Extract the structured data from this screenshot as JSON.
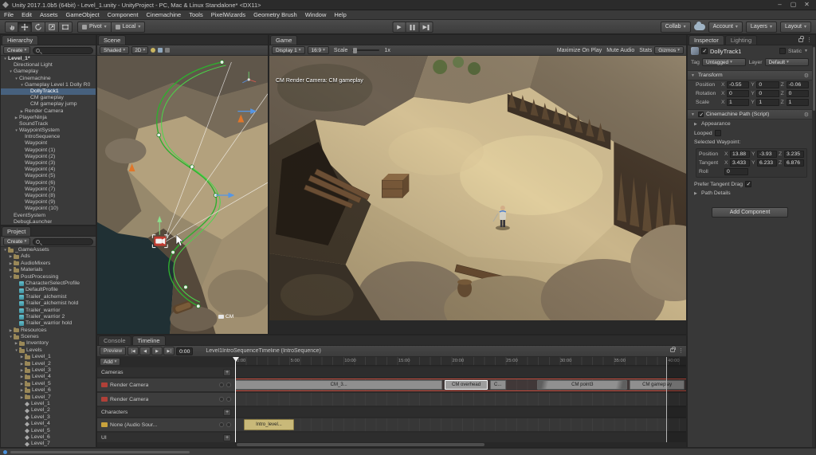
{
  "window": {
    "title": "Unity 2017.1.0b5 (64bit) - Level_1.unity - UnityProject - PC, Mac & Linux Standalone* <DX11>",
    "minimize": "–",
    "maximize": "▢",
    "close": "✕"
  },
  "menu": [
    "File",
    "Edit",
    "Assets",
    "GameObject",
    "Component",
    "Cinemachine",
    "Tools",
    "PixelWizards",
    "Geometry Brush",
    "Window",
    "Help"
  ],
  "toolbar": {
    "pivot_label": "Pivot",
    "local_label": "Local",
    "collab_label": "Collab",
    "account_label": "Account",
    "layers_label": "Layers",
    "layout_label": "Layout"
  },
  "hierarchy": {
    "tab": "Hierarchy",
    "create_label": "Create",
    "items": [
      {
        "label": "Level_1*",
        "indent": 0,
        "arrow": "v",
        "kind": "scene"
      },
      {
        "label": "Directional Light",
        "indent": 1
      },
      {
        "label": "Gameplay",
        "indent": 1,
        "arrow": "v"
      },
      {
        "label": "Cinemachine",
        "indent": 2,
        "arrow": "v"
      },
      {
        "label": "Gameplay Level 1 Dolly R0",
        "indent": 3,
        "arrow": "v"
      },
      {
        "label": "DollyTrack1",
        "indent": 4,
        "selected": true
      },
      {
        "label": "CM gameplay",
        "indent": 4
      },
      {
        "label": "CM gameplay jump",
        "indent": 4
      },
      {
        "label": "Render Camera",
        "indent": 3,
        "arrow": ">"
      },
      {
        "label": "PlayerNinja",
        "indent": 2,
        "arrow": ">"
      },
      {
        "label": "SoundTrack",
        "indent": 2
      },
      {
        "label": "WaypointSystem",
        "indent": 2,
        "arrow": "v"
      },
      {
        "label": "IntroSequence",
        "indent": 3
      },
      {
        "label": "Waypoint",
        "indent": 3
      },
      {
        "label": "Waypoint (1)",
        "indent": 3
      },
      {
        "label": "Waypoint (2)",
        "indent": 3
      },
      {
        "label": "Waypoint (3)",
        "indent": 3
      },
      {
        "label": "Waypoint (4)",
        "indent": 3
      },
      {
        "label": "Waypoint (5)",
        "indent": 3
      },
      {
        "label": "Waypoint (6)",
        "indent": 3
      },
      {
        "label": "Waypoint (7)",
        "indent": 3
      },
      {
        "label": "Waypoint (8)",
        "indent": 3
      },
      {
        "label": "Waypoint (9)",
        "indent": 3
      },
      {
        "label": "Waypoint (10)",
        "indent": 3
      },
      {
        "label": "EventSystem",
        "indent": 1
      },
      {
        "label": "DebugLauncher",
        "indent": 1
      }
    ]
  },
  "project": {
    "tab": "Project",
    "create_label": "Create",
    "items": [
      {
        "label": "_GameAssets",
        "indent": 0,
        "arrow": "v",
        "icon": "folder"
      },
      {
        "label": "Ads",
        "indent": 1,
        "arrow": ">",
        "icon": "folder"
      },
      {
        "label": "AudioMixers",
        "indent": 1,
        "arrow": ">",
        "icon": "folder"
      },
      {
        "label": "Materials",
        "indent": 1,
        "arrow": ">",
        "icon": "folder"
      },
      {
        "label": "PostProcessing",
        "indent": 1,
        "arrow": "v",
        "icon": "folder"
      },
      {
        "label": "CharacterSelectProfile",
        "indent": 2,
        "icon": "profile"
      },
      {
        "label": "DefaultProfile",
        "indent": 2,
        "icon": "profile"
      },
      {
        "label": "Trailer_alchemist",
        "indent": 2,
        "icon": "profile"
      },
      {
        "label": "Trailer_alchemist hold",
        "indent": 2,
        "icon": "profile"
      },
      {
        "label": "Trailer_warrior",
        "indent": 2,
        "icon": "profile"
      },
      {
        "label": "Trailer_warrior 2",
        "indent": 2,
        "icon": "profile"
      },
      {
        "label": "Trailer_warrior hold",
        "indent": 2,
        "icon": "profile"
      },
      {
        "label": "Resources",
        "indent": 1,
        "arrow": ">",
        "icon": "folder"
      },
      {
        "label": "Scenes",
        "indent": 1,
        "arrow": "v",
        "icon": "folder"
      },
      {
        "label": "Inventory",
        "indent": 2,
        "arrow": ">",
        "icon": "folder"
      },
      {
        "label": "Levels",
        "indent": 2,
        "arrow": "v",
        "icon": "folder"
      },
      {
        "label": "Level_1",
        "indent": 3,
        "arrow": ">",
        "icon": "folder"
      },
      {
        "label": "Level_2",
        "indent": 3,
        "arrow": ">",
        "icon": "folder"
      },
      {
        "label": "Level_3",
        "indent": 3,
        "arrow": ">",
        "icon": "folder"
      },
      {
        "label": "Level_4",
        "indent": 3,
        "arrow": ">",
        "icon": "folder"
      },
      {
        "label": "Level_5",
        "indent": 3,
        "arrow": ">",
        "icon": "folder"
      },
      {
        "label": "Level_6",
        "indent": 3,
        "arrow": ">",
        "icon": "folder"
      },
      {
        "label": "Level_7",
        "indent": 3,
        "arrow": ">",
        "icon": "folder"
      },
      {
        "label": "Level_1",
        "indent": 3,
        "icon": "scene"
      },
      {
        "label": "Level_2",
        "indent": 3,
        "icon": "scene"
      },
      {
        "label": "Level_3",
        "indent": 3,
        "icon": "scene"
      },
      {
        "label": "Level_4",
        "indent": 3,
        "icon": "scene"
      },
      {
        "label": "Level_5",
        "indent": 3,
        "icon": "scene"
      },
      {
        "label": "Level_6",
        "indent": 3,
        "icon": "scene"
      },
      {
        "label": "Level_7",
        "indent": 3,
        "icon": "scene"
      }
    ]
  },
  "scene_view": {
    "tab": "Scene",
    "shaded_label": "Shaded",
    "mode_2d": "2D",
    "cm_label": "CM"
  },
  "game_view": {
    "tab": "Game",
    "display_label": "Display 1",
    "aspect_label": "16:9",
    "scale_label": "Scale",
    "scale_value": "1x",
    "maximize_label": "Maximize On Play",
    "mute_label": "Mute Audio",
    "stats_label": "Stats",
    "gizmos_label": "Gizmos",
    "overlay": "CM Render Camera: CM gameplay"
  },
  "timeline": {
    "tab_console": "Console",
    "tab_timeline": "Timeline",
    "preview_label": "Preview",
    "transport": [
      "|◀",
      "◀",
      "▶",
      "▶|"
    ],
    "time_value": "0:00",
    "title": "Level1IntroSequenceTimeline (IntroSequence)",
    "add_label": "Add",
    "ruler_labels": [
      "0:00",
      "5:00",
      "10:00",
      "15:00",
      "20:00",
      "25:00",
      "30:00",
      "35:00",
      "40:00"
    ],
    "rows": [
      {
        "type": "group",
        "name": "Cameras"
      },
      {
        "type": "track",
        "kind": "camera",
        "name": "Render Camera",
        "armed": true,
        "clips": [
          {
            "label": "CM_3...",
            "start": 0,
            "width": 46
          },
          {
            "label": "CM overhead",
            "start": 46.5,
            "width": 9.5,
            "selected": true
          },
          {
            "label": "C...",
            "start": 56.5,
            "width": 3.5
          },
          {
            "label": "CM point3",
            "start": 67,
            "width": 20,
            "fade": true
          },
          {
            "label": "CM gameplay",
            "start": 87.5,
            "width": 12.15
          }
        ]
      },
      {
        "type": "track",
        "kind": "camera",
        "name": "Render Camera",
        "clips": []
      },
      {
        "type": "group",
        "name": "Characters"
      },
      {
        "type": "track",
        "kind": "audio",
        "name": "None (Audio Sour...",
        "clips": [
          {
            "label": "Intro_level...",
            "start": 2,
            "width": 11
          }
        ]
      },
      {
        "type": "group",
        "name": "UI"
      }
    ]
  },
  "inspector": {
    "tab_inspector": "Inspector",
    "tab_lighting": "Lighting",
    "object_name": "DollyTrack1",
    "static_label": "Static",
    "tag_label": "Tag",
    "tag_value": "Untagged",
    "layer_label": "Layer",
    "layer_value": "Default",
    "axes": {
      "x": "X",
      "y": "Y",
      "z": "Z"
    },
    "transform": {
      "title": "Transform",
      "position": {
        "label": "Position",
        "x": "-0.55",
        "y": "0",
        "z": "-0.06"
      },
      "rotation": {
        "label": "Rotation",
        "x": "0",
        "y": "0",
        "z": "0"
      },
      "scale": {
        "label": "Scale",
        "x": "1",
        "y": "1",
        "z": "1"
      }
    },
    "cinemachine": {
      "title": "Cinemachine Path (Script)",
      "appearance_label": "Appearance",
      "looped_label": "Looped",
      "selected_waypoint_label": "Selected Waypoint:",
      "position": {
        "label": "Position",
        "x": "13.88",
        "y": "-3.93",
        "z": "3.235"
      },
      "tangent": {
        "label": "Tangent",
        "x": "3.433",
        "y": "6.233",
        "z": "6.876"
      },
      "roll_label": "Roll",
      "roll_value": "0",
      "prefer_label": "Prefer Tangent Drag",
      "path_details_label": "Path Details"
    },
    "add_component_label": "Add Component"
  }
}
